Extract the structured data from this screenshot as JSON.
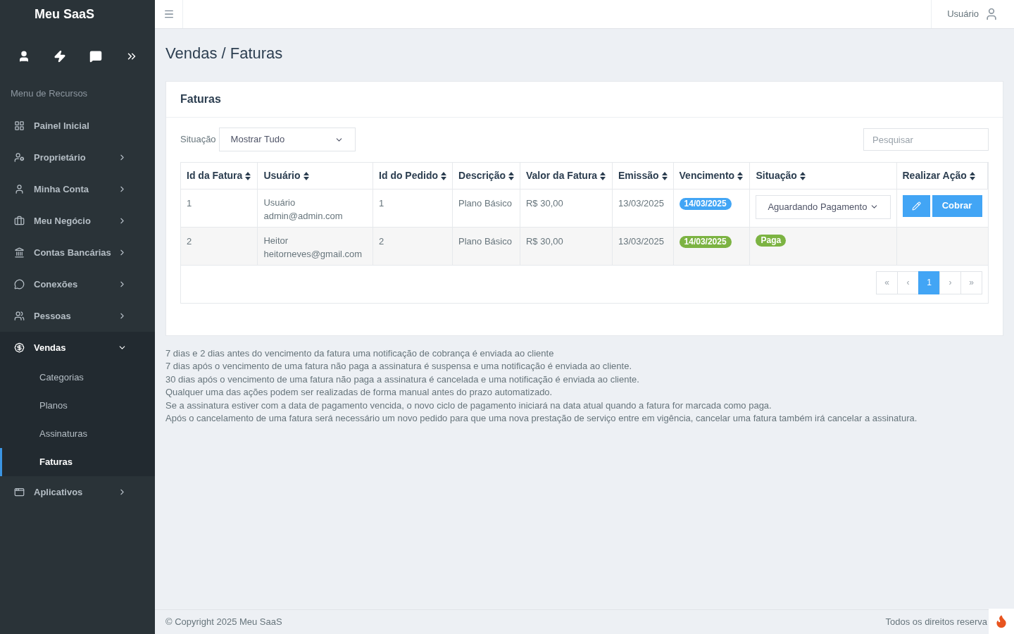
{
  "brand": "Meu SaaS",
  "sidebar": {
    "section_title": "Menu de Recursos",
    "items": [
      {
        "label": "Painel Inicial",
        "kind": "link"
      },
      {
        "label": "Proprietário",
        "kind": "group",
        "expanded": false
      },
      {
        "label": "Minha Conta",
        "kind": "group",
        "expanded": false
      },
      {
        "label": "Meu Negócio",
        "kind": "group",
        "expanded": false
      },
      {
        "label": "Contas Bancárias",
        "kind": "group",
        "expanded": false
      },
      {
        "label": "Conexões",
        "kind": "group",
        "expanded": false
      },
      {
        "label": "Pessoas",
        "kind": "group",
        "expanded": false
      },
      {
        "label": "Vendas",
        "kind": "group",
        "expanded": true,
        "children": [
          {
            "label": "Categorias",
            "selected": false
          },
          {
            "label": "Planos",
            "selected": false
          },
          {
            "label": "Assinaturas",
            "selected": false
          },
          {
            "label": "Faturas",
            "selected": true
          }
        ]
      },
      {
        "label": "Aplicativos",
        "kind": "group",
        "expanded": false
      }
    ]
  },
  "topbar": {
    "user": "Usuário"
  },
  "page_title": "Vendas / Faturas",
  "card": {
    "title": "Faturas",
    "filter_label": "Situação",
    "filter_value": "Mostrar Tudo",
    "search": {
      "placeholder": "Pesquisar"
    },
    "table": {
      "columns": [
        "Id da Fatura",
        "Usuário",
        "Id do Pedido",
        "Descrição",
        "Valor da Fatura",
        "Emissão",
        "Vencimento",
        "Situação",
        "Realizar Ação"
      ],
      "rows": [
        {
          "id": "1",
          "user_name": "Usuário",
          "user_email": "admin@admin.com",
          "order_id": "1",
          "description": "Plano Básico",
          "amount": "R$ 30,00",
          "issued": "13/03/2025",
          "due": {
            "text": "14/03/2025",
            "color": "#42a5f5"
          },
          "status": {
            "kind": "select",
            "text": "Aguardando Pagamento"
          },
          "actions": {
            "charge": "Cobrar"
          }
        },
        {
          "id": "2",
          "user_name": "Heitor",
          "user_email": "heitorneves@gmail.com",
          "order_id": "2",
          "description": "Plano Básico",
          "amount": "R$ 30,00",
          "issued": "13/03/2025",
          "due": {
            "text": "14/03/2025",
            "color": "#7cb342"
          },
          "status": {
            "kind": "badge",
            "text": "Paga",
            "color": "#7cb342"
          }
        }
      ]
    },
    "pagination": [
      {
        "label": "«",
        "selected": false
      },
      {
        "label": "‹",
        "selected": false
      },
      {
        "label": "1",
        "selected": true
      },
      {
        "label": "›",
        "selected": false
      },
      {
        "label": "»",
        "selected": false
      }
    ]
  },
  "notes": [
    "7 dias e 2 dias antes do vencimento da fatura uma notificação de cobrança é enviada ao cliente",
    "7 dias após o vencimento de uma fatura não paga a assinatura é suspensa e uma notificação é enviada ao cliente.",
    "30 dias após o vencimento de uma fatura não paga a assinatura é cancelada e uma notificação é enviada ao cliente.",
    "Qualquer uma das ações podem ser realizadas de forma manual antes do prazo automatizado.",
    "Se a assinatura estiver com a data de pagamento vencida, o novo ciclo de pagamento iniciará na data atual quando a fatura for marcada como paga.",
    "Após o cancelamento de uma fatura será necessário um novo pedido para que uma nova prestação de serviço entre em vigência, cancelar uma fatura também irá cancelar a assinatura."
  ],
  "footer": {
    "copyright": "© Copyright 2025 Meu SaaS",
    "rights": "Todos os direitos reserva"
  }
}
